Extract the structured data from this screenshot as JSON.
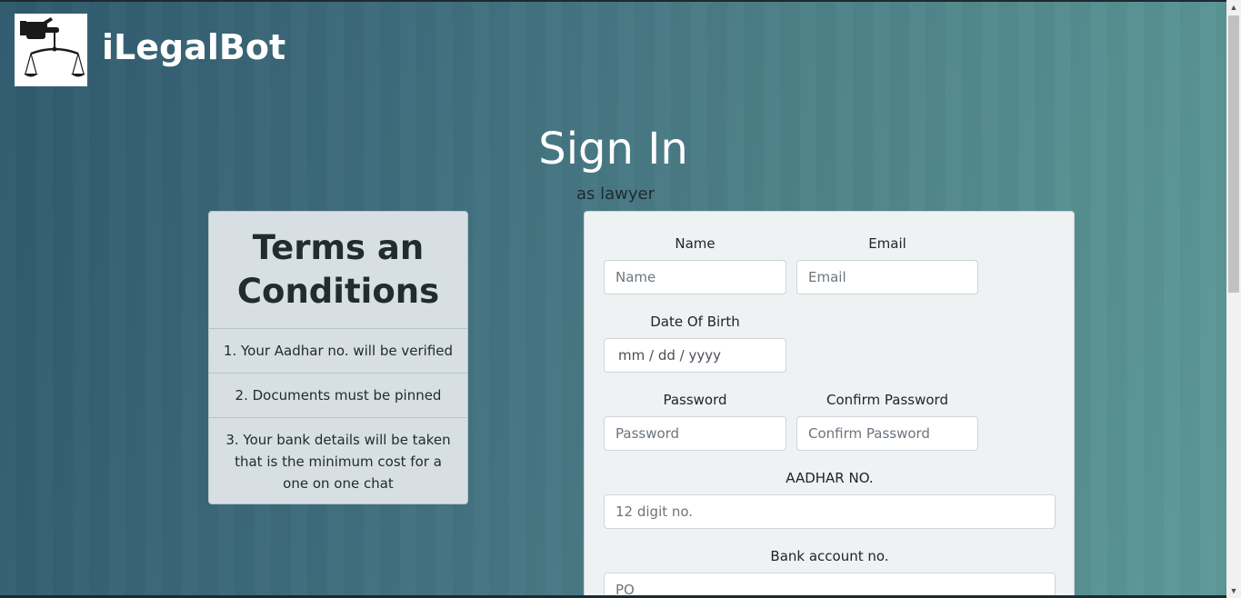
{
  "header": {
    "brand": "iLegalBot",
    "logo_icon": "gavel-scales-icon"
  },
  "page": {
    "title": "Sign In",
    "subtitle": "as lawyer"
  },
  "terms": {
    "heading": "Terms an Conditions",
    "items": [
      "1. Your Aadhar no. will be verified",
      "2. Documents must be pinned",
      "3. Your bank details will be taken that is the minimum cost for a one on one chat"
    ]
  },
  "form": {
    "name_label": "Name",
    "name_placeholder": "Name",
    "email_label": "Email",
    "email_placeholder": "Email",
    "dob_label": "Date Of Birth",
    "dob_value": "mm / dd / yyyy",
    "password_label": "Password",
    "password_placeholder": "Password",
    "confirm_label": "Confirm Password",
    "confirm_placeholder": "Confirm Password",
    "aadhar_label": "AADHAR NO.",
    "aadhar_placeholder": "12 digit no.",
    "bank_label": "Bank account no.",
    "bank_placeholder": "PO"
  },
  "colors": {
    "background_start": "#2f5a6e",
    "background_end": "#5e9a98",
    "card": "#eff2f3",
    "terms_card": "#d7dfe3"
  }
}
